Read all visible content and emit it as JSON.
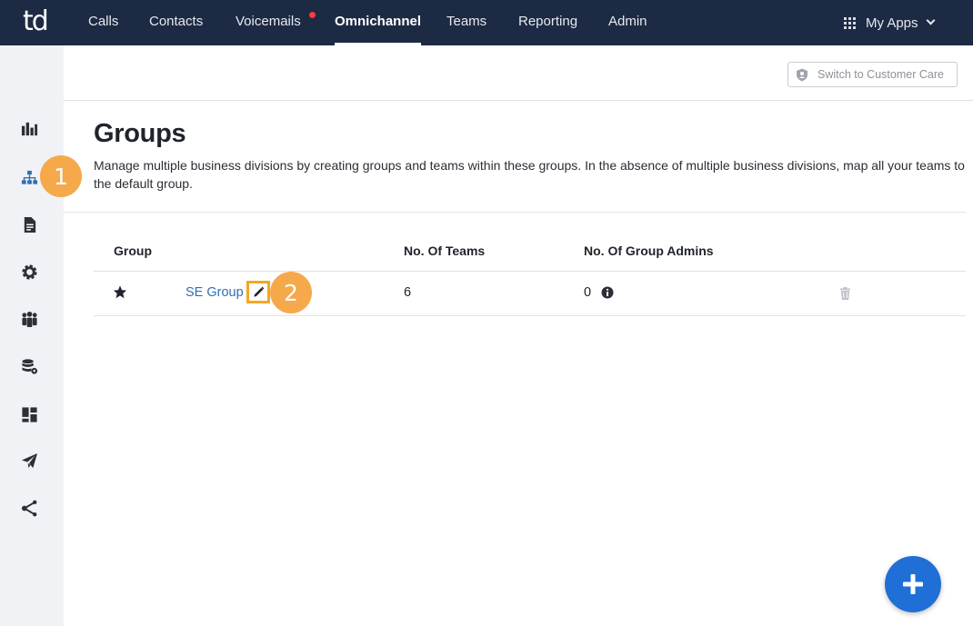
{
  "app": {
    "logo_text": "td"
  },
  "nav": {
    "items": [
      {
        "label": "Calls"
      },
      {
        "label": "Contacts"
      },
      {
        "label": "Voicemails"
      },
      {
        "label": "Omnichannel"
      },
      {
        "label": "Teams"
      },
      {
        "label": "Reporting"
      },
      {
        "label": "Admin"
      }
    ],
    "active": "Omnichannel",
    "my_apps_label": "My Apps"
  },
  "header": {
    "switch_label": "Switch to Customer Care"
  },
  "page": {
    "title": "Groups",
    "description": "Manage multiple business divisions by creating groups and teams within these groups. In the absence of multiple business divisions, map all your teams to the default group."
  },
  "table": {
    "columns": [
      "Group",
      "No. Of Teams",
      "No. Of Group Admins"
    ],
    "rows": [
      {
        "group": "SE Group",
        "teams": "6",
        "admins": "0",
        "is_default": true
      }
    ]
  },
  "callouts": [
    "1",
    "2"
  ],
  "colors": {
    "nav_bg": "#1d2a44",
    "accent": "#1f6fd6",
    "callout": "#f5a94a",
    "link": "#2f6fb3"
  },
  "icons": [
    "analytics-icon",
    "org-chart-icon",
    "document-icon",
    "gear-icon",
    "people-icon",
    "database-settings-icon",
    "dashboard-icon",
    "send-icon",
    "share-icon",
    "star-icon",
    "pencil-icon",
    "info-icon",
    "trash-icon",
    "plus-icon",
    "shield-user-icon"
  ]
}
